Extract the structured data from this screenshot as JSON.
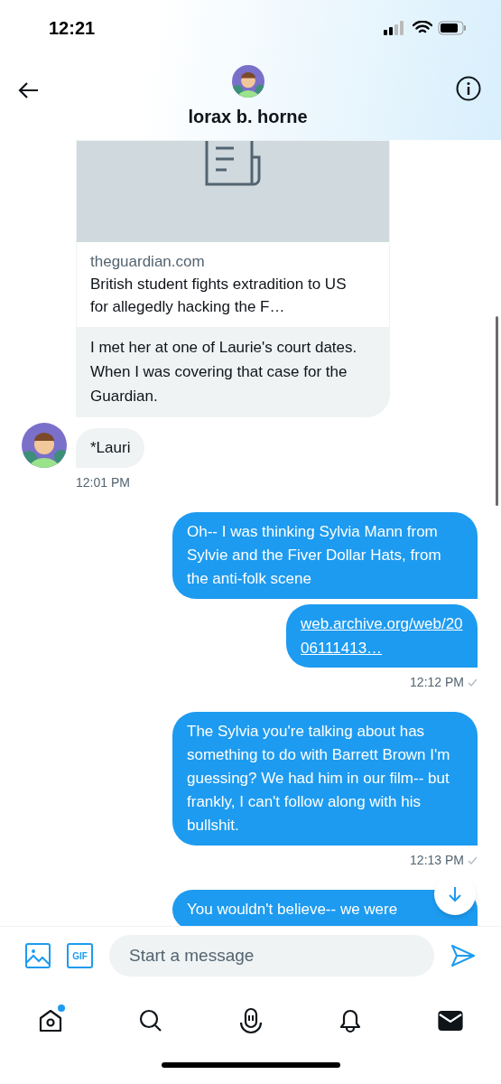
{
  "status_bar": {
    "time": "12:21"
  },
  "header": {
    "name": "lorax b. horne"
  },
  "messages": [
    {
      "kind": "link_card",
      "from_me": false,
      "domain": "theguardian.com",
      "title": "British student fights extradition to US for allegedly hacking the F…",
      "text": "I met her at one of Laurie's court dates. When I was covering that case for the Guardian."
    },
    {
      "kind": "text",
      "from_me": false,
      "avatar": true,
      "text": "*Lauri",
      "time": "12:01 PM"
    },
    {
      "kind": "text",
      "from_me": true,
      "text": "Oh-- I was thinking Sylvia Mann from Sylvie and the Fiver Dollar Hats, from the anti-folk scene"
    },
    {
      "kind": "link",
      "from_me": true,
      "text": "web.archive.org/web/2006111413…",
      "time": "12:12 PM"
    },
    {
      "kind": "text",
      "from_me": true,
      "text": "The Sylvia you're talking about has something to do with Barrett Brown I'm guessing? We had him in our film-- but frankly, I can't follow along with his bullshit.",
      "time": "12:13 PM"
    },
    {
      "kind": "text",
      "from_me": true,
      "text": "You wouldn't believe-- we were"
    }
  ],
  "composer": {
    "gif_label": "GIF",
    "placeholder": "Start a message"
  },
  "tab_bar": [
    {
      "kind": "home",
      "selected": false,
      "badge": true
    },
    {
      "kind": "search",
      "selected": false,
      "badge": false
    },
    {
      "kind": "spaces",
      "selected": false,
      "badge": false
    },
    {
      "kind": "notifications",
      "selected": false,
      "badge": false
    },
    {
      "kind": "messages",
      "selected": true,
      "badge": false
    }
  ]
}
